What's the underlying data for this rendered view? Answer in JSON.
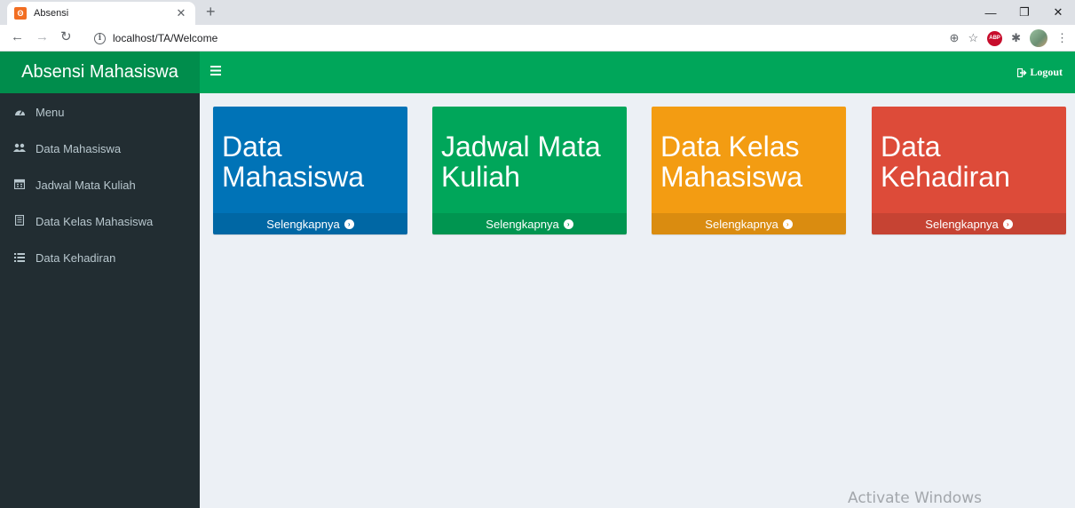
{
  "browser": {
    "tab_title": "Absensi",
    "tab_close": "✕",
    "new_tab": "+",
    "url": "localhost/TA/Welcome",
    "window": {
      "minimize": "—",
      "restore": "❐",
      "close": "✕"
    }
  },
  "app": {
    "brand": "Absensi Mahasiswa",
    "menu_toggle_icon": "bars-icon",
    "logout_label": "Logout",
    "colors": {
      "header": "#00a65a",
      "brand_bg": "#008d4c",
      "sidebar": "#222d32",
      "content_bg": "#ecf0f5"
    }
  },
  "sidebar": {
    "items": [
      {
        "label": "Menu",
        "icon": "dashboard-icon"
      },
      {
        "label": "Data Mahasiswa",
        "icon": "users-icon"
      },
      {
        "label": "Jadwal Mata Kuliah",
        "icon": "calendar-icon"
      },
      {
        "label": "Data Kelas Mahasiswa",
        "icon": "book-icon"
      },
      {
        "label": "Data Kehadiran",
        "icon": "list-icon"
      }
    ]
  },
  "boxes": [
    {
      "title": "Data Mahasiswa",
      "footer": "Selengkapnya",
      "color": "#0073b7"
    },
    {
      "title": "Jadwal Mata Kuliah",
      "footer": "Selengkapnya",
      "color": "#00a65a"
    },
    {
      "title": "Data Kelas Mahasiswa",
      "footer": "Selengkapnya",
      "color": "#f39c12"
    },
    {
      "title": "Data Kehadiran",
      "footer": "Selengkapnya",
      "color": "#dd4b39"
    }
  ],
  "watermark": "Activate Windows"
}
